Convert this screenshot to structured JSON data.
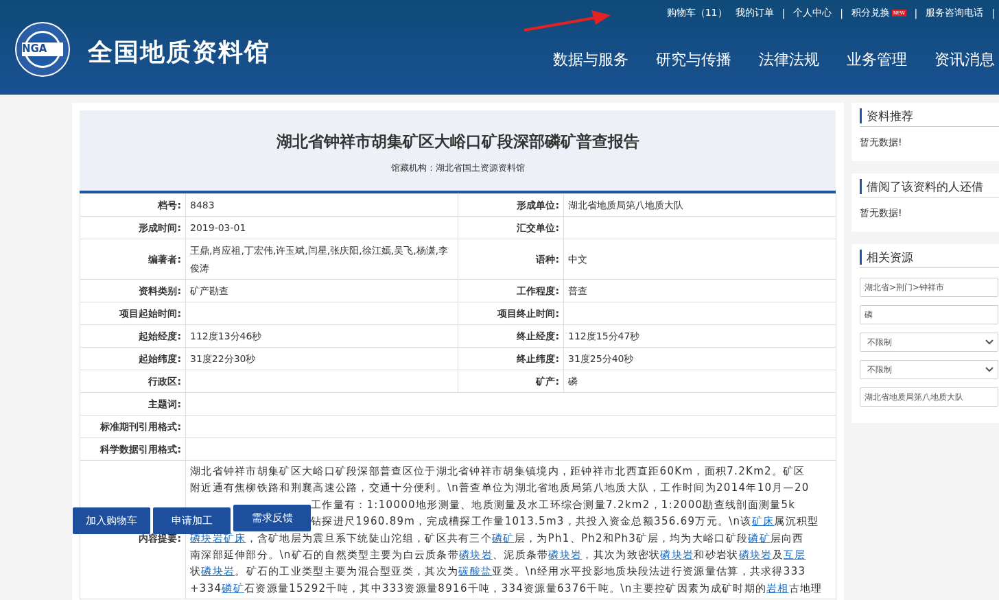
{
  "header": {
    "logo_text": "NGA",
    "site_title": "全国地质资料馆",
    "top_links": [
      {
        "label": "购物车（11）"
      },
      {
        "label": "我的订单",
        "separator_after": "|"
      },
      {
        "label": "个人中心",
        "separator_after": "|"
      },
      {
        "label": "积分兑换",
        "badge": "NEW",
        "separator_after": "|"
      },
      {
        "label": "服务咨询电话",
        "separator_after": "|"
      }
    ],
    "nav": [
      "数据与服务",
      "研究与传播",
      "法律法规",
      "业务管理",
      "资讯消息"
    ]
  },
  "report": {
    "title": "湖北省钟祥市胡集矿区大峪口矿段深部磷矿普查报告",
    "holder": "馆藏机构：湖北省国土资源资料馆",
    "rows": [
      {
        "fields": [
          {
            "label": "档号:",
            "value": "8483"
          },
          {
            "label": "形成单位:",
            "value": "湖北省地质局第八地质大队"
          }
        ]
      },
      {
        "fields": [
          {
            "label": "形成时间:",
            "value": "2019-03-01"
          },
          {
            "label": "汇交单位:"
          }
        ]
      },
      {
        "fields": [
          {
            "label": "编著者:",
            "value": "王鼎,肖应祖,丁宏伟,许玉斌,闫星,张庆阳,徐江嫣,吴飞,杨潇,李俊涛"
          },
          {
            "label": "语种:",
            "value": "中文"
          }
        ]
      },
      {
        "fields": [
          {
            "label": "资料类别:",
            "value": "矿产勘查"
          },
          {
            "label": "工作程度:",
            "value": "普查"
          }
        ]
      },
      {
        "fields": [
          {
            "label": "项目起始时间:"
          },
          {
            "label": "项目终止时间:"
          }
        ]
      },
      {
        "fields": [
          {
            "label": "起始经度:",
            "value": "112度13分46秒"
          },
          {
            "label": "终止经度:",
            "value": "112度15分47秒"
          }
        ]
      },
      {
        "fields": [
          {
            "label": "起始纬度:",
            "value": "31度22分30秒"
          },
          {
            "label": "终止纬度:",
            "value": "31度25分40秒"
          }
        ]
      },
      {
        "fields": [
          {
            "label": "行政区:"
          },
          {
            "label": "矿产:",
            "value": "磷"
          }
        ]
      },
      {
        "fields": [
          {
            "label": "主题词:"
          }
        ]
      },
      {
        "fields": [
          {
            "label": "标准期刊引用格式:"
          }
        ]
      },
      {
        "fields": [
          {
            "label": "科学数据引用格式:"
          }
        ]
      }
    ],
    "abstract_label": "内容提要:",
    "abstract_lines": [
      {
        "kind": "full",
        "segments": [
          {
            "kind": "text",
            "text": "湖北省钟祥市胡集矿区大峪口矿段深部普查区位于湖北省钟祥市胡集镇境内，距钟祥市北西直距60Km，面积7.2Km2。矿区"
          }
        ]
      },
      {
        "kind": "full",
        "segments": [
          {
            "kind": "text",
            "text": "附近通有焦柳铁路和荆襄高速公路，交通十分便利。\\n普查单位为湖北省地质局第八地质大队，工作时间为2014年10月—20"
          }
        ]
      },
      {
        "kind": "partial",
        "segments": [
          {
            "kind": "text",
            "text": "工作量有：1:10000地形测量、地质测量及水工环综合测量7.2km2，1:2000勘查线剖面测量5k"
          }
        ]
      },
      {
        "kind": "partial",
        "segments": [
          {
            "kind": "text",
            "text": "钻探进尺1960.89m，完成槽探工作量1013.5m3，共投入资金总额356.69万元。\\n该"
          },
          {
            "kind": "link",
            "text": "矿床"
          },
          {
            "kind": "text",
            "text": "属沉积型"
          }
        ]
      },
      {
        "kind": "full",
        "segments": [
          {
            "kind": "link",
            "text": "磷块岩矿床"
          },
          {
            "kind": "text",
            "text": "，含矿地层为震旦系下统陡山沱组，矿区共有三个"
          },
          {
            "kind": "link",
            "text": "磷矿"
          },
          {
            "kind": "text",
            "text": "层，为Ph1、Ph2和Ph3矿层，均为大峪口矿段"
          },
          {
            "kind": "link",
            "text": "磷矿"
          },
          {
            "kind": "text",
            "text": "层向西"
          }
        ]
      },
      {
        "kind": "full",
        "segments": [
          {
            "kind": "text",
            "text": "南深部延伸部分。\\n矿石的自然类型主要为白云质条带"
          },
          {
            "kind": "link",
            "text": "磷块岩"
          },
          {
            "kind": "text",
            "text": "、泥质条带"
          },
          {
            "kind": "link",
            "text": "磷块岩"
          },
          {
            "kind": "text",
            "text": "，其次为致密状"
          },
          {
            "kind": "link",
            "text": "磷块岩"
          },
          {
            "kind": "text",
            "text": "和砂岩状"
          },
          {
            "kind": "link",
            "text": "磷块岩"
          },
          {
            "kind": "text",
            "text": "及"
          },
          {
            "kind": "link",
            "text": "互层"
          }
        ]
      },
      {
        "kind": "full",
        "segments": [
          {
            "kind": "text",
            "text": "状"
          },
          {
            "kind": "link",
            "text": "磷块岩"
          },
          {
            "kind": "text",
            "text": "。矿石的工业类型主要为混合型亚类，其次为"
          },
          {
            "kind": "link",
            "text": "碳酸盐"
          },
          {
            "kind": "text",
            "text": "亚类。\\n经用水平投影地质块段法进行资源量估算，共求得333"
          }
        ]
      },
      {
        "kind": "full",
        "segments": [
          {
            "kind": "text",
            "text": "+334"
          },
          {
            "kind": "link",
            "text": "磷矿"
          },
          {
            "kind": "text",
            "text": "石资源量15292千吨，其中333资源量8916千吨，334资源量6376千吨。\\n主要控矿因素为成矿时期的"
          },
          {
            "kind": "link",
            "text": "岩相"
          },
          {
            "kind": "text",
            "text": "古地理"
          }
        ]
      }
    ],
    "actions": [
      "加入购物车",
      "申请加工",
      "需求反馈"
    ]
  },
  "sidebar": [
    {
      "heading": "资料推荐",
      "empty": "暂无数据!"
    },
    {
      "heading": "借阅了该资料的人还借",
      "empty": "暂无数据!"
    },
    {
      "heading": "相关资源",
      "filters": [
        {
          "kind": "input",
          "value": "湖北省>荆门>钟祥市"
        },
        {
          "kind": "input",
          "value": "磷"
        },
        {
          "kind": "select",
          "value": "不限制"
        },
        {
          "kind": "select",
          "value": "不限制"
        },
        {
          "kind": "input",
          "value": "湖北省地质局第八地质大队"
        }
      ]
    }
  ]
}
